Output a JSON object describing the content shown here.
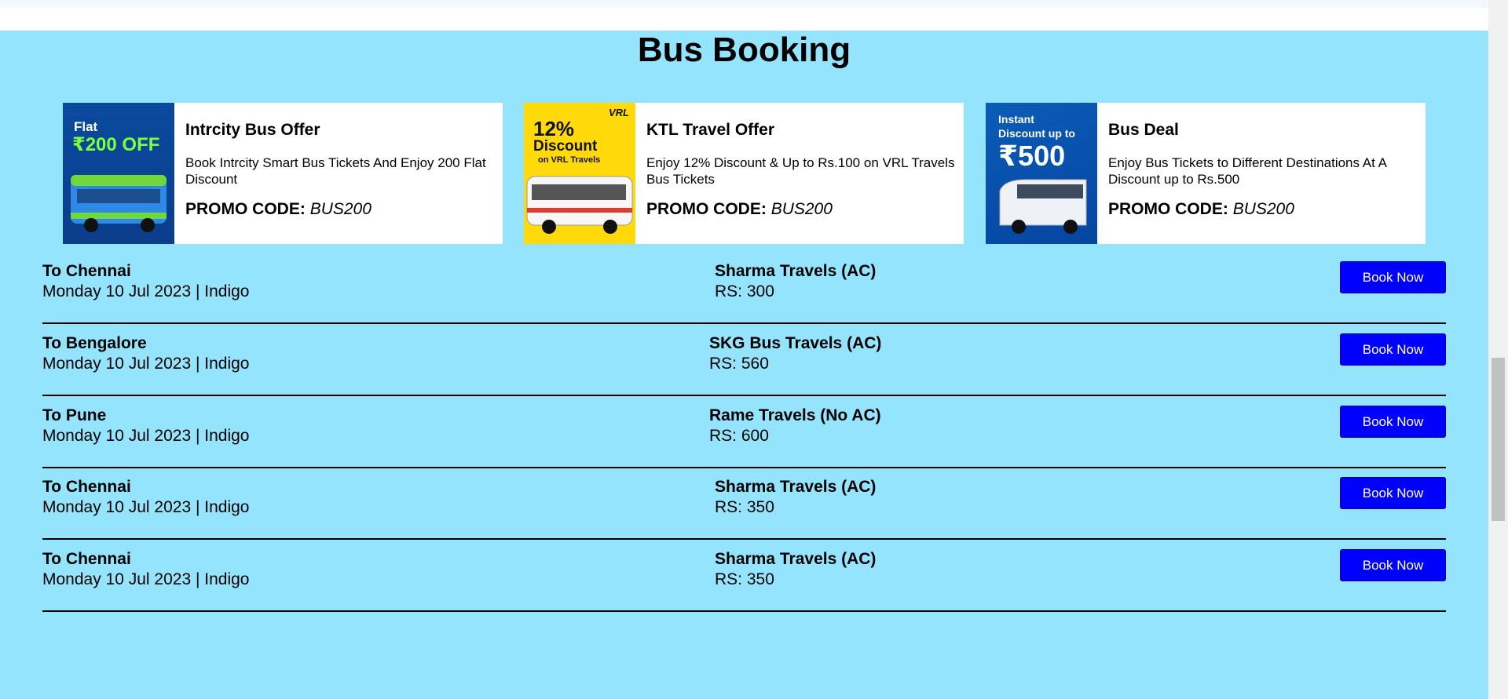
{
  "page": {
    "title": "Bus Booking"
  },
  "offers": [
    {
      "title": "Intrcity Bus Offer",
      "description": "Book Intrcity Smart Bus Tickets And Enjoy 200 Flat Discount",
      "promo_label": "PROMO CODE:",
      "promo_code": "BUS200",
      "image_text_1": "Flat",
      "image_text_2": "₹200 OFF"
    },
    {
      "title": "KTL Travel Offer",
      "description": "Enjoy 12% Discount & Up to Rs.100 on VRL Travels Bus Tickets",
      "promo_label": "PROMO CODE:",
      "promo_code": "BUS200",
      "image_text_1": "12%",
      "image_text_2": "Discount",
      "image_text_3": "on VRL Travels",
      "image_text_4": "VRL"
    },
    {
      "title": "Bus Deal",
      "description": "Enjoy Bus Tickets to Different Destinations At A Discount up to Rs.500",
      "promo_label": "PROMO CODE:",
      "promo_code": "BUS200",
      "image_text_1": "Instant",
      "image_text_2": "Discount up to",
      "image_text_3": "₹500"
    }
  ],
  "buses": [
    {
      "destination": "To Chennai",
      "date": "Monday 10 Jul 2023 | Indigo",
      "operator": "Sharma Travels (AC)",
      "price": "RS: 300",
      "button": "Book Now"
    },
    {
      "destination": "To Bengalore",
      "date": "Monday 10 Jul 2023 | Indigo",
      "operator": "SKG Bus Travels (AC)",
      "price": "RS: 560",
      "button": "Book Now"
    },
    {
      "destination": "To Pune",
      "date": "Monday 10 Jul 2023 | Indigo",
      "operator": "Rame Travels (No AC)",
      "price": "RS: 600",
      "button": "Book Now"
    },
    {
      "destination": "To Chennai",
      "date": "Monday 10 Jul 2023 | Indigo",
      "operator": "Sharma Travels (AC)",
      "price": "RS: 350",
      "button": "Book Now"
    },
    {
      "destination": "To Chennai",
      "date": "Monday 10 Jul 2023 | Indigo",
      "operator": "Sharma Travels (AC)",
      "price": "RS: 350",
      "button": "Book Now"
    }
  ],
  "colors": {
    "background": "#94e4fd",
    "button": "#0000ff",
    "card": "#ffffff"
  }
}
